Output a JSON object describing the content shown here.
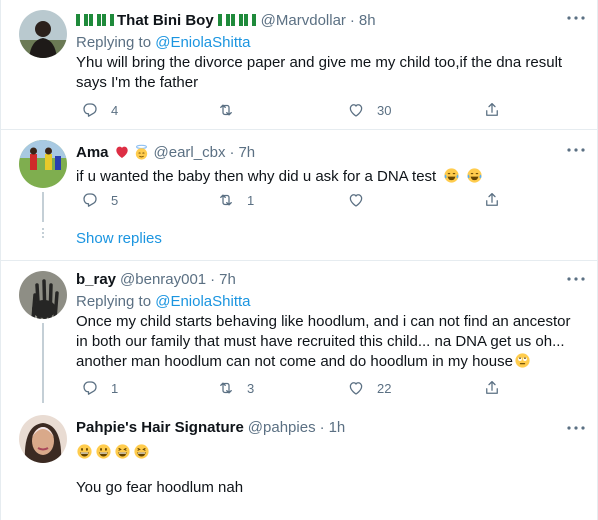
{
  "colors": {
    "accent": "#1b95e0",
    "secondary_text": "#5b7083",
    "divider": "#e6ecf0",
    "like": "#e0245e"
  },
  "tweets": [
    {
      "name": "That Bini Boy",
      "handle": "@Marvdollar",
      "separator": "·",
      "time": "8h",
      "replying_prefix": "Replying to",
      "replying_to": "@EniolaShitta",
      "text_lines": [
        "Yhu will bring the divorce paper and give me my child too,if the dna result",
        "says I'm the father"
      ],
      "replies": "4",
      "retweets": "",
      "likes": "30",
      "icons": [
        "nigeria-flag-icon",
        "more-icon",
        "reply-icon",
        "retweet-icon",
        "like-icon",
        "share-icon"
      ]
    },
    {
      "name": "Ama",
      "handle": "@earl_cbx",
      "separator": "·",
      "time": "7h",
      "text_lines": [
        "if u wanted the baby then why did u ask for a DNA test"
      ],
      "replies": "5",
      "retweets": "1",
      "likes": "",
      "icons": [
        "heart-emoji-icon",
        "angel-emoji-icon",
        "tears-of-joy-emoji-icon"
      ]
    },
    {
      "name": "b_ray",
      "handle": "@benray001",
      "separator": "·",
      "time": "7h",
      "replying_prefix": "Replying to",
      "replying_to": "@EniolaShitta",
      "text_lines": [
        "Once my child starts behaving like hoodlum, and i can not find an ancestor",
        "in both our family that must have recruited this child... na DNA get us oh...",
        "another man hoodlum can not come and do hoodlum in my house"
      ],
      "replies": "1",
      "retweets": "3",
      "likes": "22",
      "icons": [
        "eye-roll-emoji-icon"
      ]
    },
    {
      "name": "Pahpie's Hair Signature",
      "handle": "@pahpies",
      "separator": "·",
      "time": "1h",
      "text_lines": [
        "You go fear hoodlum nah"
      ],
      "icons": [
        "grinning-emoji-icon"
      ]
    }
  ],
  "show_replies": "Show replies"
}
